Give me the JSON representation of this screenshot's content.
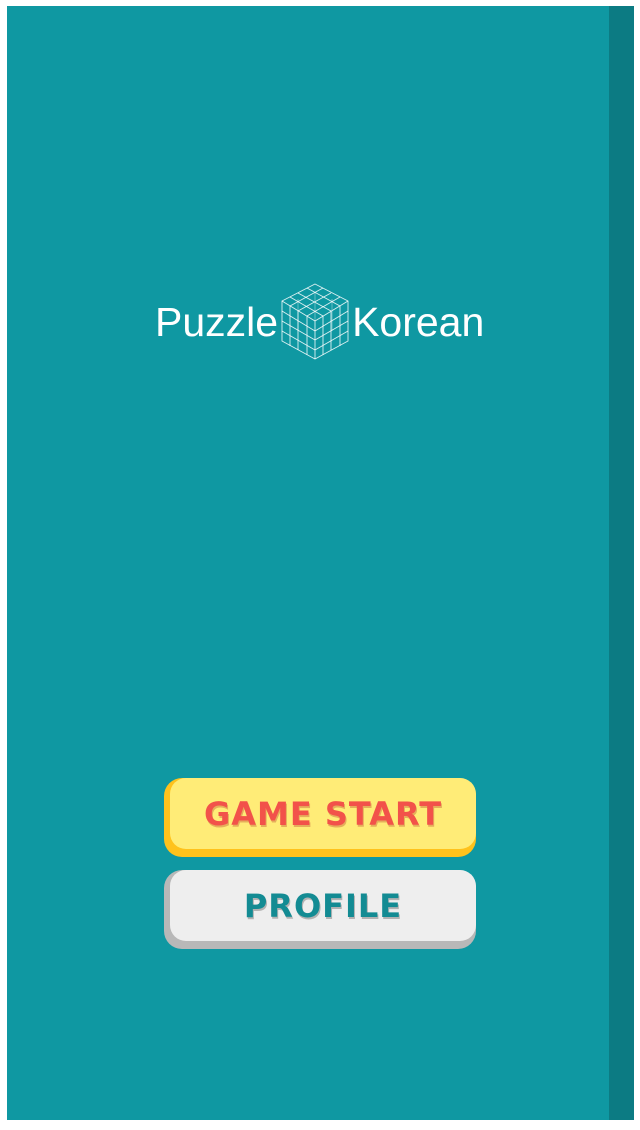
{
  "app": {
    "logo": {
      "left_word": "Puzzle",
      "right_word": "Korean",
      "icon": "wireframe-cube-icon"
    }
  },
  "menu": {
    "game_start_label": "GAME START",
    "profile_label": "PROFILE"
  },
  "colors": {
    "background": "#0f98a2",
    "edge": "#0c7b83",
    "start_button": "#ffec77",
    "start_text": "#f2524a",
    "profile_button": "#eeeeee",
    "profile_text": "#138b93"
  }
}
